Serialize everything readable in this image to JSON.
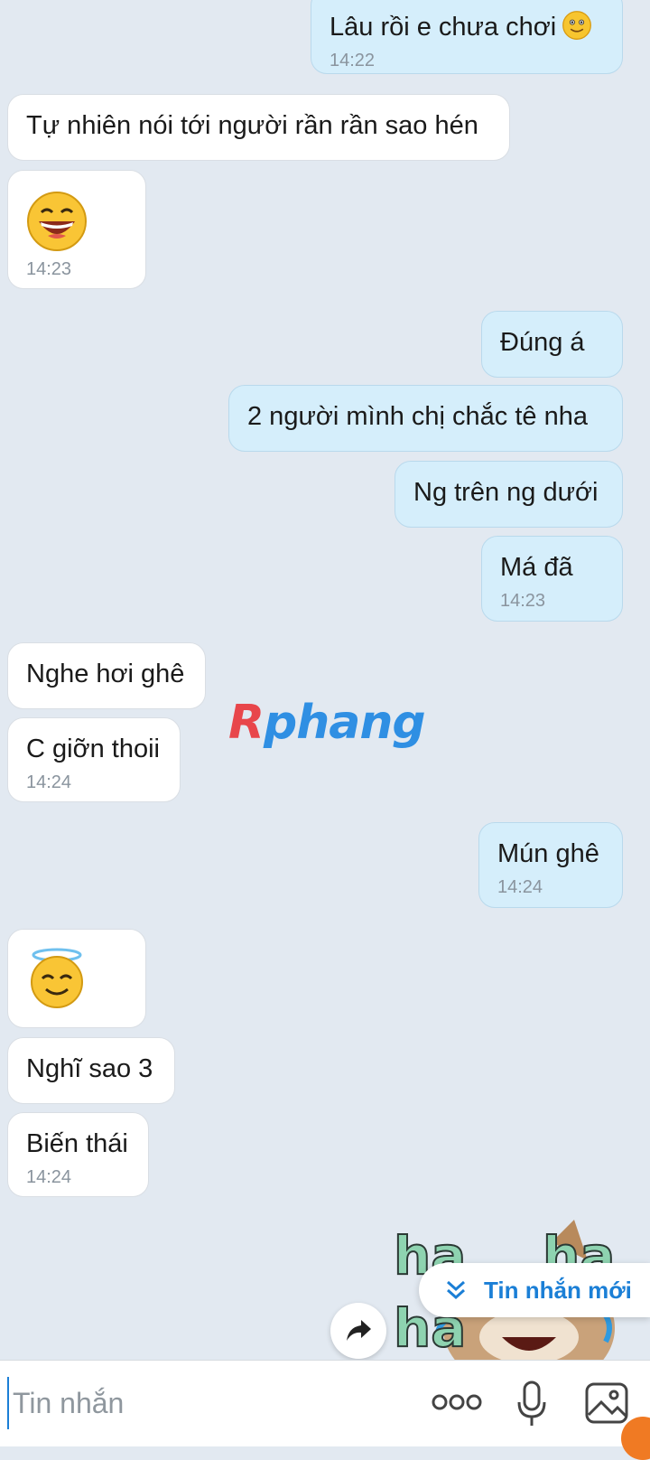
{
  "messages": [
    {
      "dir": "out",
      "text": "Lâu rồi e chưa chơi",
      "emoji": "smile-face",
      "time": "14:22"
    },
    {
      "dir": "in",
      "text": "Tự nhiên nói tới người rần rần sao hén"
    },
    {
      "dir": "in",
      "emoji": "grin-face",
      "time": "14:23"
    },
    {
      "dir": "out",
      "text": "Đúng á"
    },
    {
      "dir": "out",
      "text": "2 người mình chị chắc tê nha"
    },
    {
      "dir": "out",
      "text": "Ng trên ng dưới"
    },
    {
      "dir": "out",
      "text": "Má đã",
      "time": "14:23"
    },
    {
      "dir": "in",
      "text": "Nghe hơi ghê"
    },
    {
      "dir": "in",
      "text": "C giỡn thoii",
      "time": "14:24"
    },
    {
      "dir": "out",
      "text": "Mún ghê",
      "time": "14:24"
    },
    {
      "dir": "in",
      "emoji": "angel-face"
    },
    {
      "dir": "in",
      "text": "Nghĩ sao 3"
    },
    {
      "dir": "in",
      "text": "Biến thái",
      "time": "14:24"
    }
  ],
  "watermark": {
    "first": "R",
    "rest": "phang"
  },
  "sticker": {
    "name": "laughing-cat-sticker",
    "text": "ha ha"
  },
  "new_message_button": {
    "label": "Tin nhắn mới"
  },
  "composer": {
    "placeholder": "Tin nhắn"
  },
  "colors": {
    "background": "#e2e9f1",
    "outgoing": "#d5eefb",
    "incoming": "#ffffff",
    "accent": "#1b7fd6"
  }
}
